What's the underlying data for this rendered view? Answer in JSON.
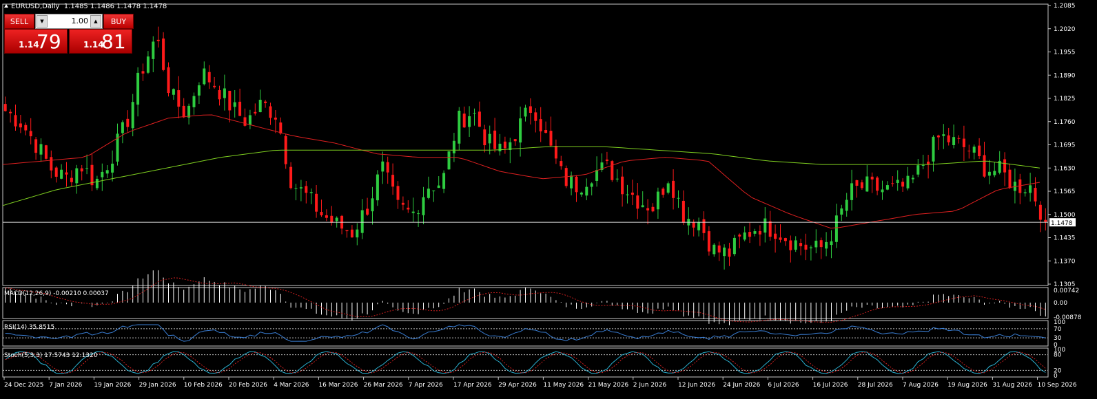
{
  "header": {
    "symbol": "EURUSD,Daily",
    "ohlc": "1.1485 1.1486 1.1478 1.1478"
  },
  "trade_panel": {
    "sell_label": "SELL",
    "buy_label": "BUY",
    "lot_value": "1.00",
    "sell_price_small": "1.14",
    "sell_price_big": "79",
    "buy_price_small": "1.14",
    "buy_price_big": "81"
  },
  "colors": {
    "bull": "#2ecc40",
    "bear": "#ff1a1a",
    "ma_fast": "#e02020",
    "ma_slow": "#7fd020",
    "macd_hist": "#ffffff",
    "macd_signal": "#d02020",
    "rsi": "#3a7fd6",
    "stoch_main": "#2ab0d0",
    "stoch_signal": "#d02020"
  },
  "chart_data": {
    "type": "candlestick",
    "current_price_label": "1.1478",
    "current_price": 1.1478,
    "ylim": [
      1.1305,
      1.2085
    ],
    "y_ticks": [
      "1.2085",
      "1.2020",
      "1.1955",
      "1.1890",
      "1.1825",
      "1.1760",
      "1.1695",
      "1.1630",
      "1.1565",
      "1.1500",
      "1.1435",
      "1.1370",
      "1.1305"
    ],
    "x_ticks": [
      "24 Dec 2025",
      "7 Jan 2026",
      "19 Jan 2026",
      "29 Jan 2026",
      "10 Feb 2026",
      "20 Feb 2026",
      "4 Mar 2026",
      "16 Mar 2026",
      "26 Mar 2026",
      "7 Apr 2026",
      "17 Apr 2026",
      "29 Apr 2026",
      "11 May 2026",
      "21 May 2026",
      "2 Jun 2026",
      "12 Jun 2026",
      "24 Jun 2026",
      "6 Jul 2026",
      "16 Jul 2026",
      "28 Jul 2026",
      "7 Aug 2026",
      "19 Aug 2026",
      "31 Aug 2026",
      "10 Sep 2026"
    ],
    "close_anchors": [
      1.179,
      1.176,
      1.17,
      1.163,
      1.16,
      1.164,
      1.159,
      1.166,
      1.175,
      1.19,
      1.2,
      1.183,
      1.178,
      1.19,
      1.186,
      1.18,
      1.176,
      1.181,
      1.178,
      1.159,
      1.155,
      1.15,
      1.147,
      1.145,
      1.152,
      1.163,
      1.152,
      1.15,
      1.158,
      1.159,
      1.176,
      1.179,
      1.17,
      1.167,
      1.174,
      1.181,
      1.17,
      1.16,
      1.158,
      1.162,
      1.163,
      1.158,
      1.154,
      1.152,
      1.161,
      1.15,
      1.148,
      1.14,
      1.139,
      1.144,
      1.147,
      1.146,
      1.143,
      1.141,
      1.14,
      1.146,
      1.156,
      1.158,
      1.157,
      1.157,
      1.158,
      1.165,
      1.172,
      1.17,
      1.168,
      1.163,
      1.162,
      1.158,
      1.158,
      1.148
    ],
    "ma_fast_anchors": [
      1.164,
      1.165,
      1.166,
      1.173,
      1.177,
      1.178,
      1.175,
      1.172,
      1.17,
      1.167,
      1.166,
      1.166,
      1.162,
      1.16,
      1.161,
      1.165,
      1.166,
      1.165,
      1.155,
      1.15,
      1.146,
      1.148,
      1.15,
      1.151,
      1.157,
      1.159
    ],
    "ma_slow_anchors": [
      1.1525,
      1.157,
      1.16,
      1.163,
      1.166,
      1.168,
      1.168,
      1.168,
      1.168,
      1.168,
      1.169,
      1.169,
      1.168,
      1.167,
      1.165,
      1.164,
      1.164,
      1.164,
      1.165,
      1.163
    ],
    "macd": {
      "label": "MACD(12,26,9) -0.00210 0.00037",
      "ticks": [
        "0.00742",
        "0.00",
        "-0.00878"
      ],
      "range": [
        -0.00878,
        0.00742
      ]
    },
    "rsi": {
      "label": "RSI(14) 35.8515",
      "ticks": [
        "100",
        "70",
        "30",
        "0"
      ],
      "levels": [
        70,
        30
      ]
    },
    "stoch": {
      "label": "Stoch(5,3,3) 17.5743 12.1320",
      "ticks": [
        "100",
        "80",
        "20",
        "0"
      ],
      "levels": [
        80,
        20
      ]
    }
  }
}
